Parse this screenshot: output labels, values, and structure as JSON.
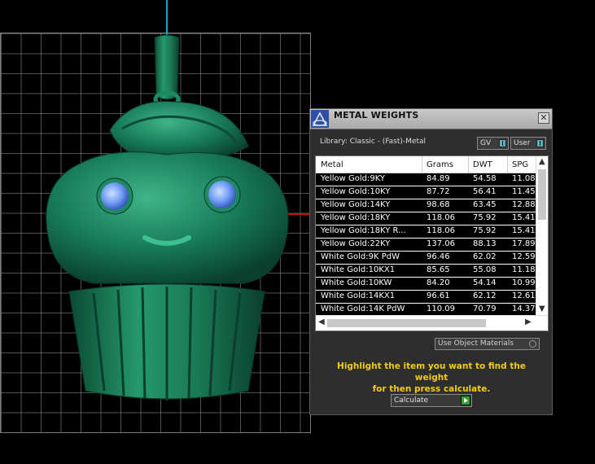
{
  "panel": {
    "title": "METAL WEIGHTS",
    "close_label": "✕",
    "library_label": "Library: Classic - (Fast)-Metal",
    "toggles": {
      "gv": "GV",
      "user": "User"
    },
    "columns": [
      "Metal",
      "Grams",
      "DWT",
      "SPG"
    ],
    "rows": [
      {
        "metal": "Yellow Gold:9KY",
        "grams": "84.89",
        "dwt": "54.58",
        "spg": "11.08"
      },
      {
        "metal": "Yellow Gold:10KY",
        "grams": "87.72",
        "dwt": "56.41",
        "spg": "11.45"
      },
      {
        "metal": "Yellow Gold:14KY",
        "grams": "98.68",
        "dwt": "63.45",
        "spg": "12.88"
      },
      {
        "metal": "Yellow Gold:18KY",
        "grams": "118.06",
        "dwt": "75.92",
        "spg": "15.41"
      },
      {
        "metal": "Yellow Gold:18KY R...",
        "grams": "118.06",
        "dwt": "75.92",
        "spg": "15.41"
      },
      {
        "metal": "Yellow Gold:22KY",
        "grams": "137.06",
        "dwt": "88.13",
        "spg": "17.89"
      },
      {
        "metal": "White Gold:9K PdW",
        "grams": "96.46",
        "dwt": "62.02",
        "spg": "12.59"
      },
      {
        "metal": "White Gold:10KX1",
        "grams": "85.65",
        "dwt": "55.08",
        "spg": "11.18"
      },
      {
        "metal": "White Gold:10KW",
        "grams": "84.20",
        "dwt": "54.14",
        "spg": "10.99"
      },
      {
        "metal": "White Gold:14KX1",
        "grams": "96.61",
        "dwt": "62.12",
        "spg": "12.61"
      },
      {
        "metal": "White Gold:14K PdW",
        "grams": "110.09",
        "dwt": "70.79",
        "spg": "14.37"
      }
    ],
    "use_object_materials": "Use Object Materials",
    "hint_line1": "Highlight the item you want to find the weight",
    "hint_line2": "for then press calculate.",
    "calculate_label": "Calculate"
  },
  "colors": {
    "model": "#1a7a5a",
    "gem": "#6ea0ff",
    "hint": "#f3cc12",
    "axis_y": "#1aa7b7",
    "axis_x": "#c81010"
  }
}
